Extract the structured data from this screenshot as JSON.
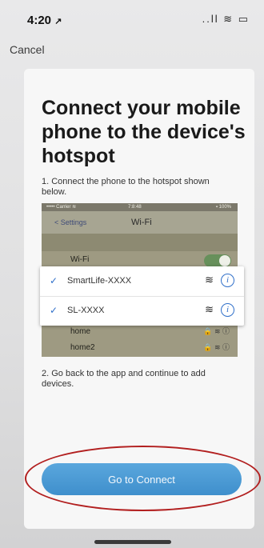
{
  "status_bar": {
    "time": "4:20",
    "location_arrow": "↗",
    "signal_icons": "..ll ≋ ▭"
  },
  "nav": {
    "cancel_label": "Cancel"
  },
  "main": {
    "title": "Connect your mobile phone to the device's hotspot",
    "step1": "1. Connect the phone to the hotspot shown below.",
    "step2": "2. Go back to the app and continue to add devices."
  },
  "illustration": {
    "status_carrier": "••••• Carrier ≋",
    "status_time": "7:8:48",
    "status_battery": "▪ 100%",
    "back_label": "< Settings",
    "title": "Wi-Fi",
    "wifi_label": "Wi-Fi",
    "popup_networks": [
      {
        "name": "SmartLife-XXXX"
      },
      {
        "name": "SL-XXXX"
      }
    ],
    "other_networks": [
      {
        "name": "home"
      },
      {
        "name": "home2"
      }
    ]
  },
  "connect_button": {
    "label": "Go to Connect"
  },
  "colors": {
    "accent": "#4a9ad6",
    "highlight_ring": "#b21f1f"
  }
}
